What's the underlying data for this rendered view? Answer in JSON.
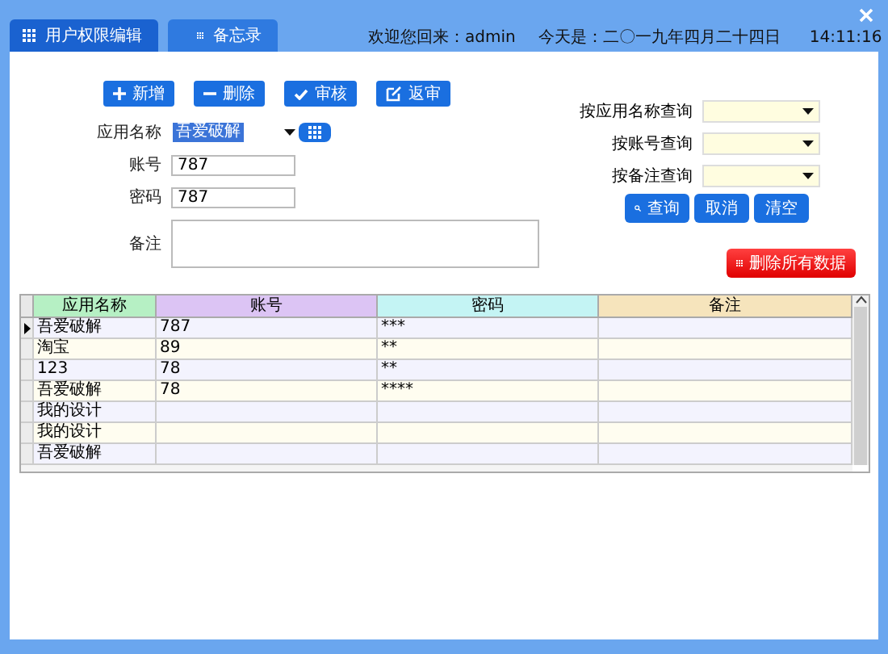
{
  "tabs": [
    {
      "label": "用户权限编辑",
      "selected": true
    },
    {
      "label": "备忘录",
      "selected": false
    }
  ],
  "header": {
    "welcome": "欢迎您回来：admin",
    "date": "今天是：二〇一九年四月二十四日",
    "time": "14:11:16"
  },
  "toolbar": [
    {
      "label": "新增",
      "kind": "add"
    },
    {
      "label": "删除",
      "kind": "remove"
    },
    {
      "label": "审核",
      "kind": "check"
    },
    {
      "label": "返审",
      "kind": "edit"
    }
  ],
  "form": {
    "app_name": {
      "label": "应用名称",
      "value": "吾爱破解"
    },
    "account": {
      "label": "账号",
      "value": "787"
    },
    "password": {
      "label": "密码",
      "value": "787"
    },
    "note": {
      "label": "备注"
    }
  },
  "query": {
    "filters": [
      {
        "label": "按应用名称查询"
      },
      {
        "label": "按账号查询"
      },
      {
        "label": "按备注查询"
      }
    ],
    "buttons": [
      {
        "label": "查询",
        "kind": "search"
      },
      {
        "label": "取消",
        "kind": "plain"
      },
      {
        "label": "清空",
        "kind": "plain"
      }
    ],
    "delete_all": "删除所有数据"
  },
  "table": {
    "columns": [
      {
        "label": "应用名称",
        "color": "#b6f0c4"
      },
      {
        "label": "账号",
        "color": "#dcc4f4"
      },
      {
        "label": "密码",
        "color": "#c4f4f4"
      },
      {
        "label": "备注",
        "color": "#f6e4bc"
      }
    ],
    "rows": [
      {
        "selected": true,
        "cells": [
          "吾爱破解",
          "787",
          "***",
          ""
        ]
      },
      {
        "selected": false,
        "cells": [
          "淘宝",
          "89",
          "**",
          ""
        ]
      },
      {
        "selected": false,
        "cells": [
          "123",
          "78",
          "**",
          ""
        ]
      },
      {
        "selected": false,
        "cells": [
          "吾爱破解",
          "78",
          "****",
          ""
        ]
      },
      {
        "selected": false,
        "cells": [
          "我的设计",
          "",
          "",
          ""
        ]
      },
      {
        "selected": false,
        "cells": [
          "我的设计",
          "",
          "",
          ""
        ]
      },
      {
        "selected": false,
        "cells": [
          "吾爱破解",
          "",
          "",
          ""
        ]
      }
    ]
  }
}
